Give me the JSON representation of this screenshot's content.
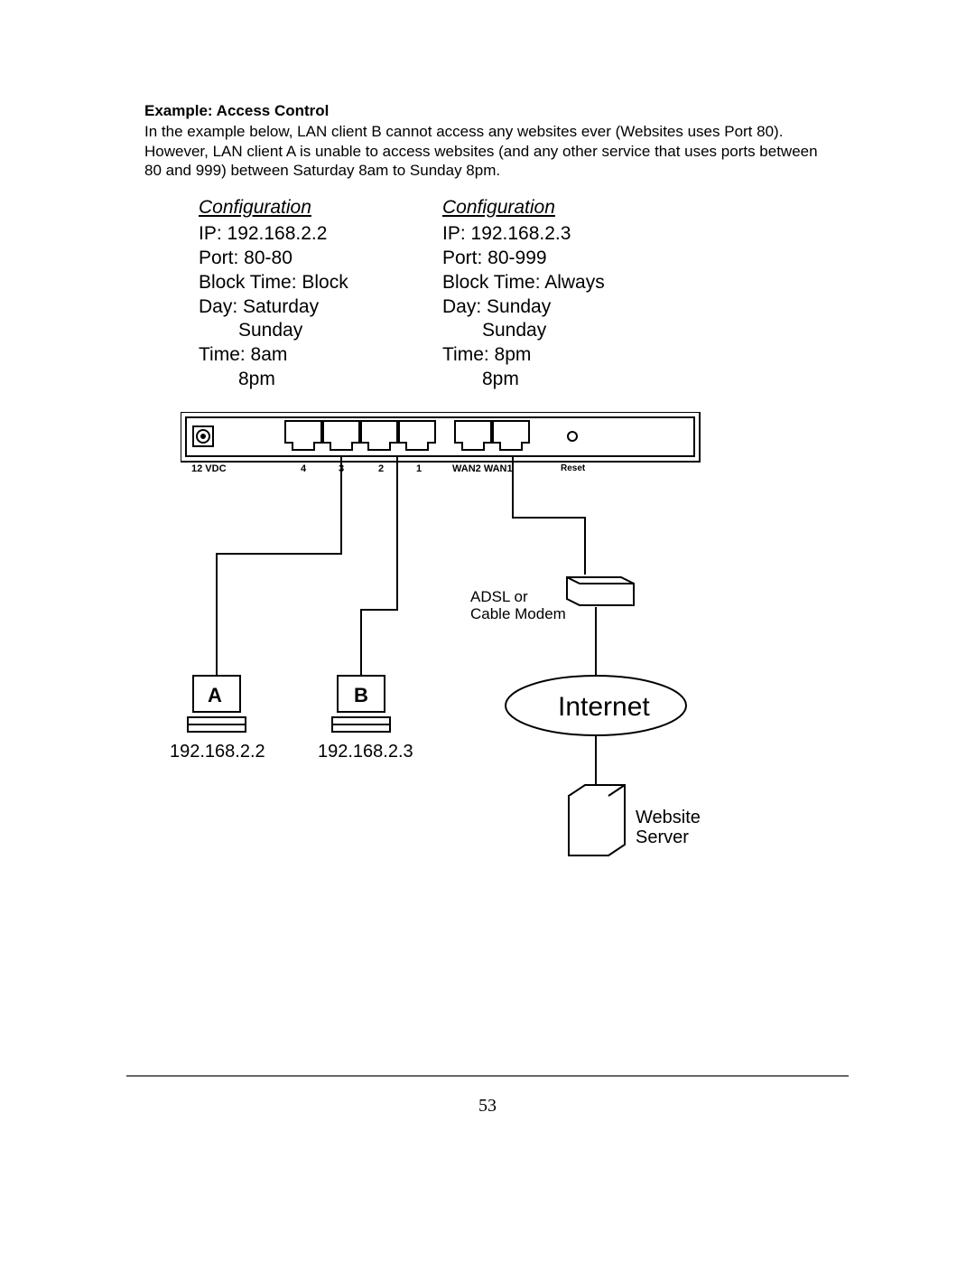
{
  "heading": "Example: Access Control",
  "body_text": "In the example below, LAN client B cannot access any websites ever (Websites uses Port 80). However, LAN client A is unable to access websites (and any other service that uses ports between 80 and 999) between Saturday 8am to Sunday 8pm.",
  "configs": [
    {
      "title": "Configuration",
      "ip": "IP: 192.168.2.2",
      "port": "Port: 80-80",
      "block_time": "Block Time: Block",
      "day1": "Day: Saturday",
      "day2": "Sunday",
      "time1": "Time: 8am",
      "time2": "8pm"
    },
    {
      "title": "Configuration",
      "ip": "IP: 192.168.2.3",
      "port": "Port: 80-999",
      "block_time": "Block Time: Always",
      "day1": "Day: Sunday",
      "day2": "Sunday",
      "time1": "Time: 8pm",
      "time2": "8pm"
    }
  ],
  "diagram": {
    "dc_label": "12 VDC",
    "port4": "4",
    "port3": "3",
    "port2": "2",
    "port1": "1",
    "wan_label": "WAN2 WAN1",
    "reset_label": "Reset",
    "modem_label_l1": "ADSL or",
    "modem_label_l2": "Cable Modem",
    "host_a": "A",
    "host_b": "B",
    "ip_a": "192.168.2.2",
    "ip_b": "192.168.2.3",
    "internet": "Internet",
    "server_l1": "Website",
    "server_l2": "Server"
  },
  "page_number": "53"
}
